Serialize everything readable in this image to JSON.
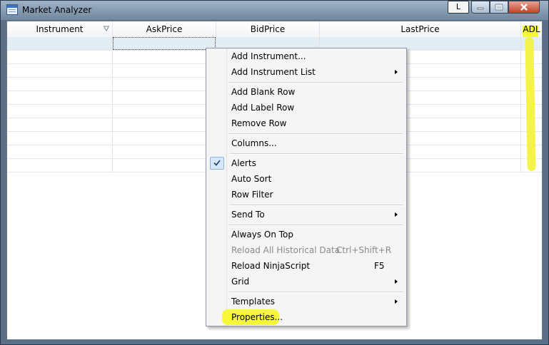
{
  "window": {
    "title": "Market Analyzer",
    "extra_button_label": "L"
  },
  "grid": {
    "columns": [
      {
        "label": "Instrument"
      },
      {
        "label": "AskPrice"
      },
      {
        "label": "BidPrice"
      },
      {
        "label": "LastPrice"
      },
      {
        "label": "ADL"
      }
    ],
    "row_count": 10
  },
  "context_menu": {
    "items": [
      {
        "label": "Add Instrument...",
        "shortcut": "",
        "submenu": false,
        "disabled": false,
        "checked": false
      },
      {
        "label": "Add Instrument List",
        "shortcut": "",
        "submenu": true,
        "disabled": false,
        "checked": false
      },
      {
        "label": "Add Blank Row",
        "shortcut": "",
        "submenu": false,
        "disabled": false,
        "checked": false
      },
      {
        "label": "Add Label Row",
        "shortcut": "",
        "submenu": false,
        "disabled": false,
        "checked": false
      },
      {
        "label": "Remove Row",
        "shortcut": "",
        "submenu": false,
        "disabled": false,
        "checked": false
      },
      {
        "label": "Columns...",
        "shortcut": "",
        "submenu": false,
        "disabled": false,
        "checked": false
      },
      {
        "label": "Alerts",
        "shortcut": "",
        "submenu": false,
        "disabled": false,
        "checked": true
      },
      {
        "label": "Auto Sort",
        "shortcut": "",
        "submenu": false,
        "disabled": false,
        "checked": false
      },
      {
        "label": "Row Filter",
        "shortcut": "",
        "submenu": false,
        "disabled": false,
        "checked": false
      },
      {
        "label": "Send To",
        "shortcut": "",
        "submenu": true,
        "disabled": false,
        "checked": false
      },
      {
        "label": "Always On Top",
        "shortcut": "",
        "submenu": false,
        "disabled": false,
        "checked": false
      },
      {
        "label": "Reload All Historical Data",
        "shortcut": "Ctrl+Shift+R",
        "submenu": false,
        "disabled": true,
        "checked": false
      },
      {
        "label": "Reload NinjaScript",
        "shortcut": "F5",
        "submenu": false,
        "disabled": false,
        "checked": false
      },
      {
        "label": "Grid",
        "shortcut": "",
        "submenu": true,
        "disabled": false,
        "checked": false
      },
      {
        "label": "Templates",
        "shortcut": "",
        "submenu": true,
        "disabled": false,
        "checked": false
      },
      {
        "label": "Properties...",
        "shortcut": "",
        "submenu": false,
        "disabled": false,
        "checked": false
      }
    ]
  },
  "colors": {
    "highlight": "#f7f73a",
    "selected_row": "#e2eef4",
    "menu_bg": "#f5f5f5"
  },
  "icons": [
    "window-app-icon",
    "sort-indicator-icon",
    "minimize-icon",
    "maximize-icon",
    "close-icon",
    "checkmark-icon",
    "submenu-arrow-icon"
  ]
}
